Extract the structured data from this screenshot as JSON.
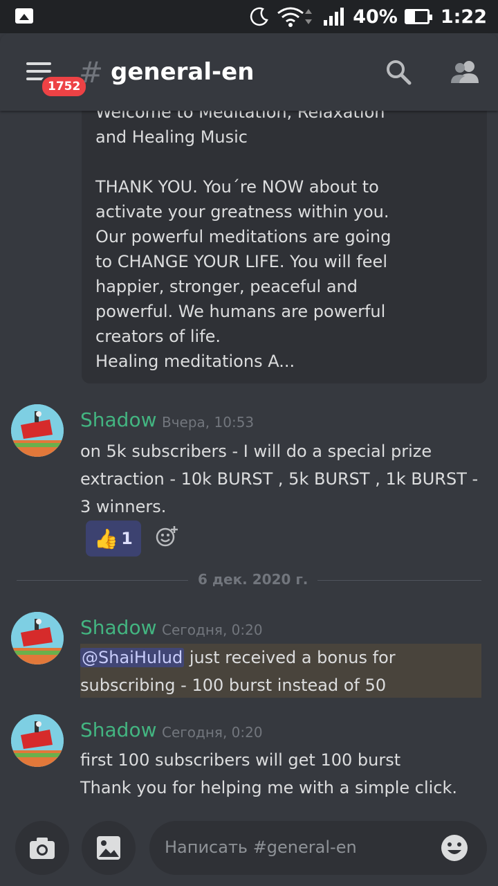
{
  "status_bar": {
    "battery": "40%",
    "time": "1:22"
  },
  "header": {
    "unread_badge": "1752",
    "hash": "#",
    "channel": "general-en"
  },
  "embed": {
    "text": "Welcome to Meditation, Relaxation\nand Healing Music\n\nTHANK YOU. You´re NOW about to\nactivate your greatness within you.\nOur powerful meditations are going\nto CHANGE YOUR LIFE. You will feel\nhappier, stronger, peaceful and\npowerful. We humans are powerful\ncreators of life.\nHealing meditations A..."
  },
  "messages": [
    {
      "author": "Shadow",
      "timestamp": "Вчера, 10:53",
      "text": "on 5k subscribers - I will do a special prize extraction - 10k BURST , 5k BURST , 1k BURST - 3 winners.",
      "reaction": {
        "emoji": "👍",
        "count": "1"
      }
    },
    {
      "author": "Shadow",
      "timestamp": "Сегодня, 0:20",
      "mention": "@ShaiHulud",
      "text": " just received a bonus for subscribing - 100 burst instead of 50"
    },
    {
      "author": "Shadow",
      "timestamp": "Сегодня, 0:20",
      "text_line1": "first 100 subscribers will get 100 burst",
      "text_line2": "Thank you for helping me with a simple click."
    }
  ],
  "date_divider": "6 дек. 2020 г.",
  "composer": {
    "placeholder": "Написать #general-en"
  },
  "colors": {
    "author": "#43b581",
    "mention": "#414675",
    "badge": "#ed4245"
  },
  "icons": [
    "image-icon",
    "moon-icon",
    "wifi-icon",
    "signal-icon",
    "battery-icon",
    "hamburger-icon",
    "search-icon",
    "members-icon",
    "add-reaction-icon",
    "camera-icon",
    "gallery-icon",
    "emoji-icon"
  ]
}
